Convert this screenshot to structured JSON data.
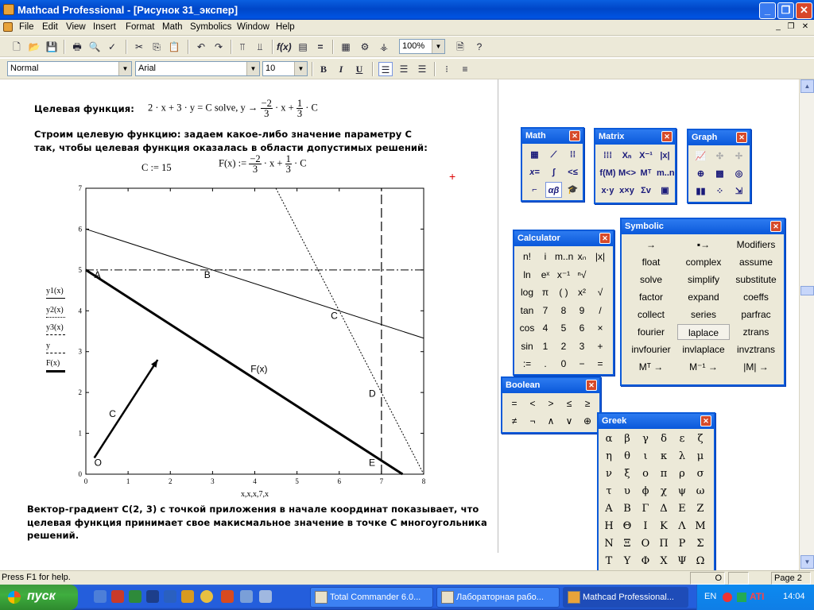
{
  "window": {
    "title": "Mathcad Professional - [Рисунок 31_экспер]",
    "buttons": {
      "minimize": "_",
      "maximize": "❐",
      "close": "✕"
    }
  },
  "menu": [
    "File",
    "Edit",
    "View",
    "Insert",
    "Format",
    "Math",
    "Symbolics",
    "Window",
    "Help"
  ],
  "toolbar": {
    "zoom": "100%",
    "style": "Normal",
    "font": "Arial",
    "size": "10",
    "bold": "B",
    "italic": "I",
    "underline": "U"
  },
  "worksheet": {
    "objective_label": "Целевая функция:",
    "objective_expr": "2 · x + 3 · y = C solve, y →",
    "frac1": {
      "num": "−2",
      "den": "3"
    },
    "mid1": "· x +",
    "frac2": {
      "num": "1",
      "den": "3"
    },
    "tail1": "· C",
    "para1_line1": "Строим целевую функцию: задаем какое-либо значение параметру С",
    "para1_line2": "так, чтобы целевая функция оказалась в области допустимых решений:",
    "c_def": "C := 15",
    "f_def": "F(x) :=",
    "f_frac1": {
      "num": "−2",
      "den": "3"
    },
    "f_mid": "· x +",
    "f_frac2": {
      "num": "1",
      "den": "3"
    },
    "f_tail": "· C",
    "para2_line1": "Вектор-градиент С(2, 3) с точкой приложения в начале координат показывает, что",
    "para2_line2": "целевая функция принимает свое макисмальное значение в точке С многоугольника",
    "para2_line3": "решений."
  },
  "chart_data": {
    "type": "line",
    "xlabel": "x,x,x,7,x",
    "xlim": [
      0,
      8
    ],
    "ylim": [
      0,
      7
    ],
    "xticks": [
      0,
      1,
      2,
      3,
      4,
      5,
      6,
      7,
      8
    ],
    "yticks": [
      0,
      1,
      2,
      3,
      4,
      5,
      6,
      7
    ],
    "legend": [
      "y1(x)",
      "y2(x)",
      "y3(x)",
      "y",
      "F(x)"
    ],
    "series": [
      {
        "name": "y1(x)",
        "style": "solid",
        "x": [
          0,
          8
        ],
        "y": [
          6,
          3.33
        ]
      },
      {
        "name": "y2(x)",
        "style": "dotted",
        "x": [
          4.5,
          8
        ],
        "y": [
          7,
          0
        ]
      },
      {
        "name": "y3(x)",
        "style": "dashdot",
        "x": [
          0,
          8
        ],
        "y": [
          5,
          5
        ]
      },
      {
        "name": "y",
        "style": "dashed",
        "x": [
          7,
          7
        ],
        "y": [
          0,
          7
        ]
      },
      {
        "name": "F(x)",
        "style": "bold",
        "x": [
          0,
          7.5
        ],
        "y": [
          5,
          0
        ]
      }
    ],
    "gradient_arrow": {
      "from": [
        0.2,
        0.4
      ],
      "to": [
        1.7,
        2.8
      ],
      "label": "C"
    },
    "point_labels": [
      {
        "text": "A",
        "x": 0.2,
        "y": 4.8
      },
      {
        "text": "B",
        "x": 2.8,
        "y": 4.8
      },
      {
        "text": "C",
        "x": 5.8,
        "y": 3.8
      },
      {
        "text": "D",
        "x": 6.7,
        "y": 1.9
      },
      {
        "text": "E",
        "x": 6.7,
        "y": 0.2
      },
      {
        "text": "O",
        "x": 0.2,
        "y": 0.2
      },
      {
        "text": "F(x)",
        "x": 3.9,
        "y": 2.5
      }
    ]
  },
  "palettes": {
    "math": {
      "title": "Math"
    },
    "matrix": {
      "title": "Matrix"
    },
    "graph": {
      "title": "Graph"
    },
    "calculator": {
      "title": "Calculator",
      "rows": [
        [
          "n!",
          "i",
          "m..n",
          "xₙ",
          "|x|"
        ],
        [
          "ln",
          "eˣ",
          "x⁻¹",
          "ⁿ√",
          ""
        ],
        [
          "log",
          "π",
          "( )",
          "x²",
          "√"
        ],
        [
          "tan",
          "7",
          "8",
          "9",
          "/"
        ],
        [
          "cos",
          "4",
          "5",
          "6",
          "×"
        ],
        [
          "sin",
          "1",
          "2",
          "3",
          "+"
        ],
        [
          ":=",
          ".",
          "0",
          "−",
          "="
        ]
      ]
    },
    "symbolic": {
      "title": "Symbolic",
      "rows": [
        [
          "→",
          "▪→",
          "Modifiers"
        ],
        [
          "float",
          "complex",
          "assume"
        ],
        [
          "solve",
          "simplify",
          "substitute"
        ],
        [
          "factor",
          "expand",
          "coeffs"
        ],
        [
          "collect",
          "series",
          "parfrac"
        ],
        [
          "fourier",
          "laplace",
          "ztrans"
        ],
        [
          "invfourier",
          "invlaplace",
          "invztrans"
        ],
        [
          "Mᵀ →",
          "M⁻¹ →",
          "|M| →"
        ]
      ]
    },
    "boolean": {
      "title": "Boolean",
      "rows": [
        [
          "=",
          "<",
          ">",
          "≤",
          "≥"
        ],
        [
          "≠",
          "¬",
          "∧",
          "∨",
          "⊕"
        ]
      ]
    },
    "greek": {
      "title": "Greek",
      "rows": [
        [
          "α",
          "β",
          "γ",
          "δ",
          "ε",
          "ζ"
        ],
        [
          "η",
          "θ",
          "ι",
          "κ",
          "λ",
          "μ"
        ],
        [
          "ν",
          "ξ",
          "ο",
          "π",
          "ρ",
          "σ"
        ],
        [
          "τ",
          "υ",
          "ϕ",
          "χ",
          "ψ",
          "ω"
        ],
        [
          "Α",
          "Β",
          "Γ",
          "Δ",
          "Ε",
          "Ζ"
        ],
        [
          "Η",
          "Θ",
          "Ι",
          "Κ",
          "Λ",
          "Μ"
        ],
        [
          "Ν",
          "Ξ",
          "Ο",
          "Π",
          "Ρ",
          "Σ"
        ],
        [
          "Τ",
          "Υ",
          "Φ",
          "Χ",
          "Ψ",
          "Ω"
        ]
      ]
    }
  },
  "status": {
    "help": "Press F1 for help.",
    "mode": "O",
    "page": "Page 2"
  },
  "taskbar": {
    "start": "пуск",
    "tasks": [
      "Total Commander 6.0...",
      "Лабораторная рабо...",
      "Mathcad Professional..."
    ],
    "lang": "EN",
    "clock": "14:04"
  }
}
